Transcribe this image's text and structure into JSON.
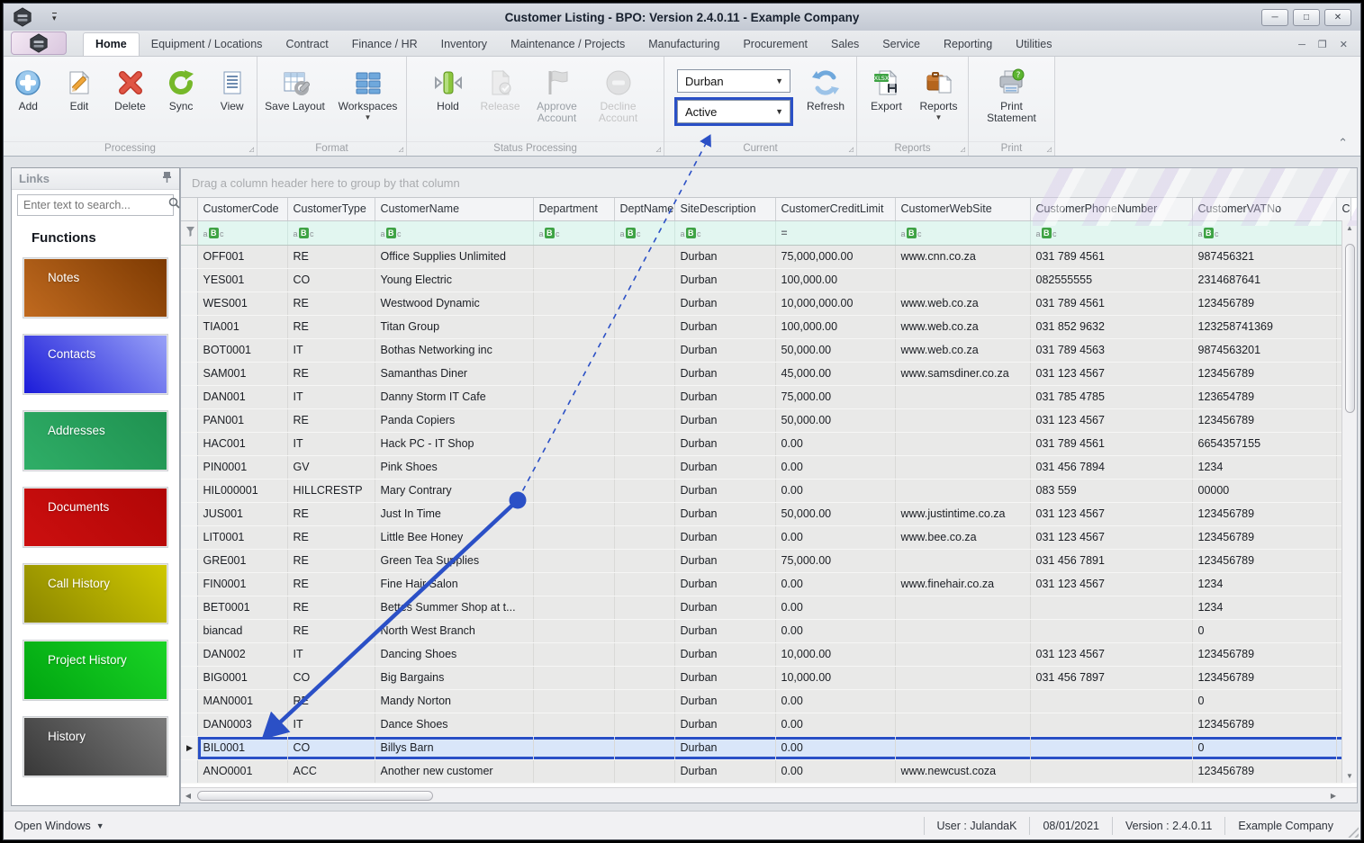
{
  "window": {
    "title": "Customer Listing - BPO: Version 2.4.0.11 - Example Company"
  },
  "tabs": [
    "Home",
    "Equipment / Locations",
    "Contract",
    "Finance / HR",
    "Inventory",
    "Maintenance / Projects",
    "Manufacturing",
    "Procurement",
    "Sales",
    "Service",
    "Reporting",
    "Utilities"
  ],
  "ribbon": {
    "groups": {
      "processing": {
        "label": "Processing",
        "buttons": {
          "add": "Add",
          "edit": "Edit",
          "delete": "Delete",
          "sync": "Sync",
          "view": "View"
        }
      },
      "format": {
        "label": "Format",
        "buttons": {
          "save_layout": "Save Layout",
          "workspaces": "Workspaces"
        }
      },
      "status_processing": {
        "label": "Status Processing",
        "buttons": {
          "hold": "Hold",
          "release": "Release",
          "approve": "Approve Account",
          "decline": "Decline Account"
        }
      },
      "current": {
        "label": "Current",
        "site_value": "Durban",
        "status_value": "Active",
        "refresh": "Refresh"
      },
      "reports": {
        "label": "Reports",
        "buttons": {
          "export": "Export",
          "reports": "Reports"
        }
      },
      "print": {
        "label": "Print",
        "buttons": {
          "print_statement": "Print Statement"
        }
      }
    }
  },
  "sidebar": {
    "title": "Links",
    "search_placeholder": "Enter text to search...",
    "functions_label": "Functions",
    "items": [
      {
        "label": "Notes",
        "colors": [
          "#c06a1f",
          "#7d3a02"
        ]
      },
      {
        "label": "Contacts",
        "colors": [
          "#1b1bd9",
          "#98a1f7"
        ]
      },
      {
        "label": "Addresses",
        "colors": [
          "#2fae67",
          "#1f9150"
        ]
      },
      {
        "label": "Documents",
        "colors": [
          "#cc0f0f",
          "#b00606"
        ]
      },
      {
        "label": "Call History",
        "colors": [
          "#8a8500",
          "#cfc800"
        ]
      },
      {
        "label": "Project History",
        "colors": [
          "#00a510",
          "#1ad426"
        ]
      },
      {
        "label": "History",
        "colors": [
          "#383838",
          "#7a7a7a"
        ]
      }
    ]
  },
  "grid": {
    "group_by_hint": "Drag a column header here to group by that column",
    "columns": [
      "CustomerCode",
      "CustomerType",
      "CustomerName",
      "Department",
      "DeptName",
      "SiteDescription",
      "CustomerCreditLimit",
      "CustomerWebSite",
      "CustomerPhoneNumber",
      "CustomerVATNo",
      "C"
    ],
    "filters": [
      "abc",
      "abc",
      "abc",
      "abc",
      "abc",
      "abc",
      "eq",
      "abc",
      "abc",
      "abc",
      ""
    ],
    "selected_row_code": "BIL0001",
    "rows": [
      [
        "OFF001",
        "RE",
        "Office Supplies Unlimited",
        "",
        "",
        "Durban",
        "75,000,000.00",
        "www.cnn.co.za",
        "031 789 4561",
        "987456321"
      ],
      [
        "YES001",
        "CO",
        "Young Electric",
        "",
        "",
        "Durban",
        "100,000.00",
        "",
        "082555555",
        "2314687641"
      ],
      [
        "WES001",
        "RE",
        "Westwood Dynamic",
        "",
        "",
        "Durban",
        "10,000,000.00",
        "www.web.co.za",
        "031 789 4561",
        "123456789"
      ],
      [
        "TIA001",
        "RE",
        "Titan Group",
        "",
        "",
        "Durban",
        "100,000.00",
        "www.web.co.za",
        "031 852 9632",
        "123258741369"
      ],
      [
        "BOT0001",
        "IT",
        "Bothas Networking inc",
        "",
        "",
        "Durban",
        "50,000.00",
        "www.web.co.za",
        "031 789 4563",
        "9874563201"
      ],
      [
        "SAM001",
        "RE",
        "Samanthas Diner",
        "",
        "",
        "Durban",
        "45,000.00",
        "www.samsdiner.co.za",
        "031 123 4567",
        "123456789"
      ],
      [
        "DAN001",
        "IT",
        "Danny Storm IT Cafe",
        "",
        "",
        "Durban",
        "75,000.00",
        "",
        "031 785 4785",
        "123654789"
      ],
      [
        "PAN001",
        "RE",
        "Panda Copiers",
        "",
        "",
        "Durban",
        "50,000.00",
        "",
        "031 123 4567",
        "123456789"
      ],
      [
        "HAC001",
        "IT",
        "Hack PC - IT Shop",
        "",
        "",
        "Durban",
        "0.00",
        "",
        "031 789 4561",
        "6654357155"
      ],
      [
        "PIN0001",
        "GV",
        "Pink Shoes",
        "",
        "",
        "Durban",
        "0.00",
        "",
        "031 456 7894",
        "1234"
      ],
      [
        "HIL000001",
        "HILLCRESTP",
        "Mary Contrary",
        "",
        "",
        "Durban",
        "0.00",
        "",
        "083 559",
        "00000"
      ],
      [
        "JUS001",
        "RE",
        "Just In Time",
        "",
        "",
        "Durban",
        "50,000.00",
        "www.justintime.co.za",
        "031 123 4567",
        "123456789"
      ],
      [
        "LIT0001",
        "RE",
        "Little Bee Honey",
        "",
        "",
        "Durban",
        "0.00",
        "www.bee.co.za",
        "031 123 4567",
        "123456789"
      ],
      [
        "GRE001",
        "RE",
        "Green Tea Supplies",
        "",
        "",
        "Durban",
        "75,000.00",
        "",
        "031 456 7891",
        "123456789"
      ],
      [
        "FIN0001",
        "RE",
        "Fine Hair Salon",
        "",
        "",
        "Durban",
        "0.00",
        "www.finehair.co.za",
        "031 123 4567",
        "1234"
      ],
      [
        "BET0001",
        "RE",
        "Bettes Summer Shop at t...",
        "",
        "",
        "Durban",
        "0.00",
        "",
        "",
        "1234"
      ],
      [
        "biancad",
        "RE",
        "North West Branch",
        "",
        "",
        "Durban",
        "0.00",
        "",
        "",
        "0"
      ],
      [
        "DAN002",
        "IT",
        "Dancing Shoes",
        "",
        "",
        "Durban",
        "10,000.00",
        "",
        "031 123 4567",
        "123456789"
      ],
      [
        "BIG0001",
        "CO",
        "Big Bargains",
        "",
        "",
        "Durban",
        "10,000.00",
        "",
        "031 456 7897",
        "123456789"
      ],
      [
        "MAN0001",
        "RE",
        "Mandy Norton",
        "",
        "",
        "Durban",
        "0.00",
        "",
        "",
        "0"
      ],
      [
        "DAN0003",
        "IT",
        "Dance Shoes",
        "",
        "",
        "Durban",
        "0.00",
        "",
        "",
        "123456789"
      ],
      [
        "BIL0001",
        "CO",
        "Billys Barn",
        "",
        "",
        "Durban",
        "0.00",
        "",
        "",
        "0"
      ],
      [
        "ANO0001",
        "ACC",
        "Another new customer",
        "",
        "",
        "Durban",
        "0.00",
        "www.newcust.coza",
        "",
        "123456789"
      ]
    ]
  },
  "statusbar": {
    "open_windows": "Open Windows",
    "user": "User : JulandaK",
    "date": "08/01/2021",
    "version": "Version : 2.4.0.11",
    "company": "Example Company"
  },
  "annotation": {
    "color": "#2b50c6"
  }
}
